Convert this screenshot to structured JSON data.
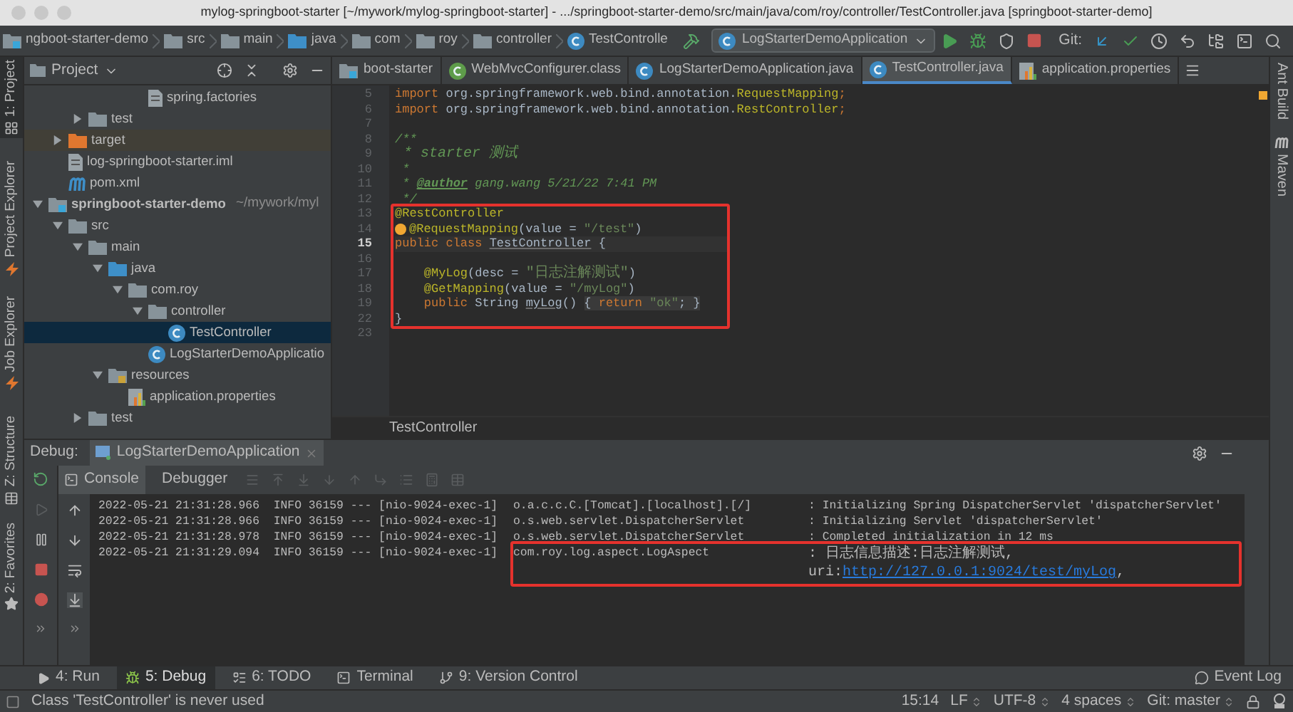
{
  "window": {
    "title": "mylog-springboot-starter [~/mywork/mylog-springboot-starter] - .../springboot-starter-demo/src/main/java/com/roy/controller/TestController.java [springboot-starter-demo]"
  },
  "navbar": {
    "breadcrumbs": [
      {
        "label": "ngboot-starter-demo",
        "kind": "module"
      },
      {
        "label": "src",
        "kind": "folder"
      },
      {
        "label": "main",
        "kind": "folder"
      },
      {
        "label": "java",
        "kind": "source-folder"
      },
      {
        "label": "com",
        "kind": "folder"
      },
      {
        "label": "roy",
        "kind": "folder"
      },
      {
        "label": "controller",
        "kind": "folder"
      },
      {
        "label": "TestControlle",
        "kind": "class"
      }
    ],
    "run_config": "LogStarterDemoApplication",
    "vcs_label": "Git:"
  },
  "left_stripe": [
    {
      "label": "1: Project",
      "selected": true
    },
    {
      "label": "Project Explorer",
      "selected": false
    },
    {
      "label": "Job Explorer",
      "selected": false
    },
    {
      "label": "Z: Structure",
      "selected": false
    },
    {
      "label": "2: Favorites",
      "selected": false
    }
  ],
  "project_panel": {
    "title": "Project",
    "tree": [
      {
        "children": [
          {
            "children": [
              {
                "children": [
                  {
                    "children": [
                      {
                        "children": [
                          {
                            "label": "spring.factories",
                            "kind": "file",
                            "selected": false
                          }
                        ]
                      }
                    ]
                  }
                ]
              },
              {
                "label": "test",
                "kind": "folder",
                "expanded": false,
                "selected": false
              }
            ]
          },
          {
            "label": "target",
            "kind": "excluded-folder",
            "expanded": false,
            "selected": false
          },
          {
            "label": "log-springboot-starter.iml",
            "kind": "file",
            "selected": false
          },
          {
            "label": "pom.xml",
            "kind": "maven",
            "selected": false
          }
        ]
      },
      {
        "label": "springboot-starter-demo",
        "suffix": "~/mywork/myl",
        "kind": "module",
        "expanded": true,
        "selected": false,
        "children": [
          {
            "label": "src",
            "kind": "folder",
            "expanded": true,
            "selected": false,
            "children": [
              {
                "label": "main",
                "kind": "folder",
                "expanded": true,
                "selected": false,
                "children": [
                  {
                    "label": "java",
                    "kind": "source-folder",
                    "expanded": true,
                    "selected": false,
                    "children": [
                      {
                        "label": "com.roy",
                        "kind": "folder",
                        "expanded": true,
                        "selected": false,
                        "children": [
                          {
                            "label": "controller",
                            "kind": "folder",
                            "expanded": true,
                            "selected": false,
                            "children": [
                              {
                                "label": "TestController",
                                "kind": "class",
                                "selected": true
                              }
                            ]
                          },
                          {
                            "label": "LogStarterDemoApplicatio",
                            "kind": "class",
                            "selected": false
                          }
                        ]
                      }
                    ]
                  },
                  {
                    "label": "resources",
                    "kind": "resources",
                    "expanded": true,
                    "selected": false,
                    "children": [
                      {
                        "label": "application.properties",
                        "kind": "properties",
                        "selected": false
                      }
                    ]
                  }
                ]
              },
              {
                "label": "test",
                "kind": "folder",
                "expanded": false,
                "selected": false
              }
            ]
          }
        ]
      }
    ]
  },
  "editor": {
    "tabs": [
      {
        "label": "boot-starter",
        "kind": "module",
        "selected": false
      },
      {
        "label": "WebMvcConfigurer.class",
        "kind": "interface",
        "selected": false
      },
      {
        "label": "LogStarterDemoApplication.java",
        "kind": "class",
        "selected": false
      },
      {
        "label": "TestController.java",
        "kind": "class",
        "selected": true
      },
      {
        "label": "application.properties",
        "kind": "properties",
        "selected": false
      }
    ],
    "lines_before": [
      {
        "num": "5",
        "current": false,
        "tokens": [
          {
            "t": "import ",
            "kind": "keyword"
          },
          {
            "t": "org.springframework.web.bind.annotation.",
            "kind": "plain"
          },
          {
            "t": "RequestMapping",
            "kind": "annotation"
          },
          {
            "t": ";",
            "kind": "keyword"
          }
        ]
      },
      {
        "num": "6",
        "current": false,
        "tokens": [
          {
            "t": "import ",
            "kind": "keyword"
          },
          {
            "t": "org.springframework.web.bind.annotation.",
            "kind": "plain"
          },
          {
            "t": "RestController",
            "kind": "annotation"
          },
          {
            "t": ";",
            "kind": "keyword"
          }
        ]
      },
      {
        "num": "7",
        "current": false
      },
      {
        "num": "8",
        "current": false,
        "tokens": [
          {
            "t": "/**",
            "kind": "comment"
          }
        ]
      },
      {
        "num": "9",
        "current": false,
        "tokens": [
          {
            "t": " * starter 测试",
            "kind": "comment"
          }
        ]
      },
      {
        "num": "10",
        "current": false,
        "tokens": [
          {
            "t": " *",
            "kind": "comment"
          }
        ]
      },
      {
        "num": "11",
        "current": false,
        "tokens": [
          {
            "t": " * ",
            "kind": "comment"
          },
          {
            "t": "@author",
            "kind": "doctag"
          },
          {
            "t": " gang.wang 5/21/22 7:41 PM",
            "kind": "comment"
          }
        ]
      },
      {
        "num": "12",
        "current": false,
        "tokens": [
          {
            "t": " */",
            "kind": "comment"
          }
        ]
      }
    ],
    "highlighted_lines": [
      {
        "num": "13",
        "current": false,
        "tokens": [
          {
            "t": "@RestController",
            "kind": "annotation"
          }
        ]
      },
      {
        "num": "14",
        "current": false,
        "bulb": true,
        "tokens": [
          {
            "t": "@RequestMapping",
            "kind": "annotation"
          },
          {
            "t": "(value = ",
            "kind": "plain"
          },
          {
            "t": "\"/test\"",
            "kind": "string"
          },
          {
            "t": ")",
            "kind": "plain"
          }
        ]
      },
      {
        "num": "15",
        "current": true,
        "tokens": [
          {
            "t": "public class ",
            "kind": "keyword"
          },
          {
            "t": "TestController",
            "kind": "reference"
          },
          {
            "t": " {",
            "kind": "plain"
          }
        ]
      },
      {
        "num": "16",
        "current": false
      },
      {
        "num": "17",
        "current": false,
        "tokens": [
          {
            "t": "    @MyLog",
            "kind": "annotation"
          },
          {
            "t": "(desc = ",
            "kind": "plain"
          },
          {
            "t": "\"日志注解测试\"",
            "kind": "string"
          },
          {
            "t": ")",
            "kind": "plain"
          }
        ]
      },
      {
        "num": "18",
        "current": false,
        "tokens": [
          {
            "t": "    @GetMapping",
            "kind": "annotation"
          },
          {
            "t": "(value = ",
            "kind": "plain"
          },
          {
            "t": "\"/myLog\"",
            "kind": "string"
          },
          {
            "t": ")",
            "kind": "plain"
          }
        ]
      },
      {
        "num": "19",
        "current": false,
        "tokens": [
          {
            "t": "    public ",
            "kind": "keyword"
          },
          {
            "t": "String ",
            "kind": "plain"
          },
          {
            "t": "myLog",
            "kind": "reference"
          },
          {
            "t": "() ",
            "kind": "plain"
          },
          {
            "t": "{ ",
            "kind": "folded"
          },
          {
            "t": "return ",
            "kind": "folded-keyword"
          },
          {
            "t": "\"ok\"",
            "kind": "folded-string"
          },
          {
            "t": "; }",
            "kind": "folded"
          }
        ]
      },
      {
        "num": "22",
        "current": false,
        "tokens": [
          {
            "t": "}",
            "kind": "plain"
          }
        ]
      }
    ],
    "lines_after": [
      {
        "num": "23",
        "current": false
      }
    ],
    "breadcrumb": "TestController"
  },
  "right_stripe": [
    {
      "label": "Ant Build"
    },
    {
      "label": "Maven"
    }
  ],
  "debug": {
    "label": "Debug:",
    "session_tab": "LogStarterDemoApplication",
    "tabs": [
      {
        "label": "Console",
        "selected": true
      },
      {
        "label": "Debugger",
        "selected": false
      }
    ],
    "console": [
      {
        "text": "2022-05-21 21:31:28.966  INFO 36159 --- [nio-9024-exec-1]",
        "logger": "o.a.c.c.C.[Tomcat].[localhost].[/]",
        "message": ": Initializing Spring DispatcherServlet 'dispatcherServlet'",
        "marked": false
      },
      {
        "text": "2022-05-21 21:31:28.966  INFO 36159 --- [nio-9024-exec-1]",
        "logger": "o.s.web.servlet.DispatcherServlet",
        "message": ": Initializing Servlet 'dispatcherServlet'",
        "marked": false
      },
      {
        "text": "2022-05-21 21:31:28.978  INFO 36159 --- [nio-9024-exec-1]",
        "logger": "o.s.web.servlet.DispatcherServlet",
        "message": ": Completed initialization in 12 ms",
        "marked": false
      },
      {
        "text": "2022-05-21 21:31:29.094  INFO 36159 --- [nio-9024-exec-1]",
        "logger": "com.roy.log.aspect.LogAspect",
        "message": ": 日志信息描述:日志注解测试, uri:",
        "link": "http://127.0.0.1:9024/test/myLog",
        "after": ",",
        "marked": true
      }
    ]
  },
  "tool_tabs": [
    {
      "label": "4: Run",
      "kind": "run",
      "selected": false
    },
    {
      "label": "5: Debug",
      "kind": "debug",
      "selected": true
    },
    {
      "label": "6: TODO",
      "kind": "todo",
      "selected": false
    },
    {
      "label": "Terminal",
      "kind": "terminal",
      "selected": false
    },
    {
      "label": "9: Version Control",
      "kind": "vcs",
      "selected": false
    }
  ],
  "event_log": "Event Log",
  "status_bar": {
    "message": "Class 'TestController' is never used",
    "position": "15:14",
    "items": [
      "LF",
      "UTF-8",
      "4 spaces",
      "Git: master"
    ]
  }
}
